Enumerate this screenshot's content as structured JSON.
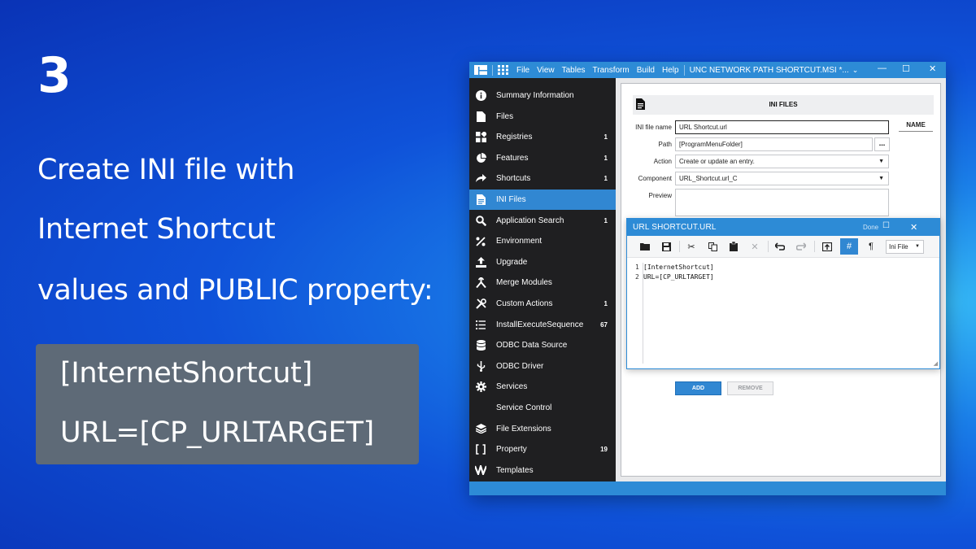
{
  "slide": {
    "step": "3",
    "heading": [
      "Create INI file with",
      "Internet Shortcut",
      "values and PUBLIC property:"
    ],
    "code": [
      "[InternetShortcut]",
      "URL=[CP_URLTARGET]"
    ]
  },
  "window": {
    "menu": [
      "File",
      "View",
      "Tables",
      "Transform",
      "Build",
      "Help"
    ],
    "title": "UNC NETWORK PATH SHORTCUT.MSI *...",
    "title_chevron": "⌄",
    "controls": {
      "minimize": "—",
      "maximize": "☐",
      "close": "✕"
    }
  },
  "sidebar": {
    "items": [
      {
        "label": "Summary Information",
        "icon": "info-icon",
        "count": ""
      },
      {
        "label": "Files",
        "icon": "file-icon",
        "count": ""
      },
      {
        "label": "Registries",
        "icon": "registry-icon",
        "count": "1"
      },
      {
        "label": "Features",
        "icon": "pie-chart-icon",
        "count": "1"
      },
      {
        "label": "Shortcuts",
        "icon": "shortcut-arrow-icon",
        "count": "1"
      },
      {
        "label": "INI Files",
        "icon": "document-icon",
        "count": "",
        "active": true
      },
      {
        "label": "Application Search",
        "icon": "search-icon",
        "count": "1"
      },
      {
        "label": "Environment",
        "icon": "percent-icon",
        "count": ""
      },
      {
        "label": "Upgrade",
        "icon": "upload-icon",
        "count": ""
      },
      {
        "label": "Merge Modules",
        "icon": "merge-icon",
        "count": ""
      },
      {
        "label": "Custom Actions",
        "icon": "tools-icon",
        "count": "1"
      },
      {
        "label": "InstallExecuteSequence",
        "icon": "list-icon",
        "count": "67"
      },
      {
        "label": "ODBC Data Source",
        "icon": "database-icon",
        "count": ""
      },
      {
        "label": "ODBC Driver",
        "icon": "usb-icon",
        "count": ""
      },
      {
        "label": "Services",
        "icon": "gear-icon",
        "count": ""
      },
      {
        "label": "Service Control",
        "icon": "service-control-icon",
        "count": ""
      },
      {
        "label": "File Extensions",
        "icon": "layers-icon",
        "count": ""
      },
      {
        "label": "Property",
        "icon": "brackets-icon",
        "count": "19"
      },
      {
        "label": "Templates",
        "icon": "templates-icon",
        "count": ""
      }
    ]
  },
  "ini_panel": {
    "title": "INI FILES",
    "labels": {
      "file_name": "INI file name",
      "path": "Path",
      "action": "Action",
      "component": "Component",
      "preview": "Preview"
    },
    "values": {
      "file_name": "URL Shortcut.url",
      "path": "[ProgramMenuFolder]",
      "action": "Create or update an entry.",
      "component": "URL_Shortcut.url_C"
    },
    "browse_label": "...",
    "name_column": "NAME",
    "add_label": "ADD",
    "remove_label": "REMOVE"
  },
  "editor": {
    "title": "URL SHORTCUT.URL",
    "done_label": "Done",
    "format_select": "Ini File",
    "lines": [
      {
        "num": "1",
        "text": "[InternetShortcut]"
      },
      {
        "num": "2",
        "text": "URL=[CP_URLTARGET]"
      }
    ]
  }
}
